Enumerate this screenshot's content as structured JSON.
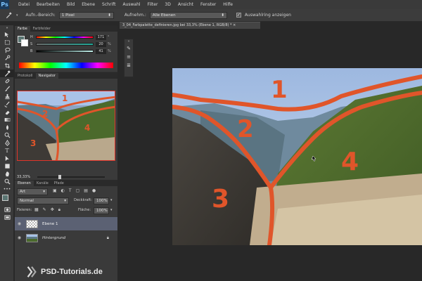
{
  "app": {
    "logo": "Ps"
  },
  "menu": [
    "Datei",
    "Bearbeiten",
    "Bild",
    "Ebene",
    "Schrift",
    "Auswahl",
    "Filter",
    "3D",
    "Ansicht",
    "Fenster",
    "Hilfe"
  ],
  "options": {
    "size_label": "Aufn.-Bereich:",
    "size_value": "1 Pixel",
    "sample_label": "Aufnehm.:",
    "sample_value": "Alle Ebenen",
    "show_ring_label": "Auswahlring anzeigen",
    "show_ring_checked": true
  },
  "color_panel": {
    "tabs": [
      "Farbe",
      "Farbfelder"
    ],
    "sliders": [
      {
        "label": "H",
        "value": "171",
        "unit": "°"
      },
      {
        "label": "S",
        "value": "20",
        "unit": "%"
      },
      {
        "label": "B",
        "value": "41",
        "unit": "%"
      }
    ]
  },
  "navigator": {
    "tabs": [
      "Protokoll",
      "Navigator"
    ],
    "zoom": "33,33%"
  },
  "layers": {
    "tabs": [
      "Ebenen",
      "Kanäle",
      "Pfade"
    ],
    "filter": "Art",
    "blend_mode": "Normal",
    "opacity_label": "Deckkraft:",
    "opacity_value": "100%",
    "lock_label": "Fixieren:",
    "fill_label": "Fläche:",
    "fill_value": "100%",
    "items": [
      {
        "name": "Ebene 1",
        "selected": true
      },
      {
        "name": "Hintergrund",
        "selected": false
      }
    ]
  },
  "document": {
    "tab_title": "3_04_Farbpalette_definieren.jpg bei 33,3% (Ebene 1, RGB/8) *"
  },
  "annotations": [
    "1",
    "2",
    "3",
    "4"
  ],
  "watermark": {
    "text": "PSD-Tutorials.de"
  },
  "colors": {
    "annotation": "#e0552a",
    "selection": "#e0342a",
    "ui_dark": "#282828",
    "ui_panel": "#3a3a3a"
  }
}
